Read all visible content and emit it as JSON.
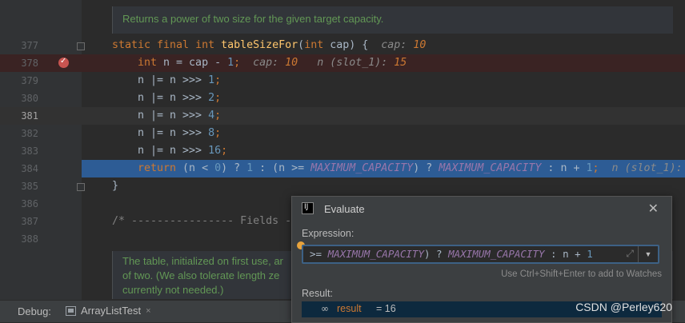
{
  "doc_top": {
    "text": "Returns a power of two size for the given target capacity."
  },
  "lines": [
    {
      "num": "377"
    },
    {
      "num": "378"
    },
    {
      "num": "379"
    },
    {
      "num": "380"
    },
    {
      "num": "381"
    },
    {
      "num": "382"
    },
    {
      "num": "383"
    },
    {
      "num": "384"
    },
    {
      "num": "385"
    },
    {
      "num": "386"
    },
    {
      "num": "387"
    },
    {
      "num": "388"
    }
  ],
  "code": {
    "l377": {
      "kw": "static final int ",
      "fn": "tableSizeFor",
      "rest1": "(",
      "kw2": "int",
      "rest2": " cap) {",
      "hint": "cap: ",
      "hintv": "10"
    },
    "l378": {
      "kw": "int ",
      "rest": "n = cap - ",
      "num": "1",
      "semi": ";",
      "hint1": "cap: ",
      "hintv1": "10",
      "hint2": "n (slot_1): ",
      "hintv2": "15"
    },
    "l379": {
      "rest": "n |= n >>> ",
      "num": "1",
      "semi": ";"
    },
    "l380": {
      "rest": "n |= n >>> ",
      "num": "2",
      "semi": ";"
    },
    "l381": {
      "rest": "n |= n >>> ",
      "num": "4",
      "semi": ";"
    },
    "l382": {
      "rest": "n |= n >>> ",
      "num": "8",
      "semi": ";"
    },
    "l383": {
      "rest": "n |= n >>> ",
      "num": "16",
      "semi": ";"
    },
    "l384": {
      "kw": "return ",
      "p1": "(n < ",
      "n0": "0",
      "p2": ") ? ",
      "n1": "1",
      "p3": " : (n >= ",
      "c1": "MAXIMUM_CAPACITY",
      "p4": ") ? ",
      "c2": "MAXIMUM_CAPACITY",
      "p5": " : n + ",
      "n2": "1",
      "p6": ";",
      "hint": "n (slot_1):"
    },
    "l385": {
      "rest": "}"
    },
    "l387": {
      "comment": "/* ---------------- Fields -"
    }
  },
  "doc_bottom": {
    "line1": "The table, initialized on first use, ar",
    "line2": "of two. (We also tolerate length ze",
    "line3": "currently not needed.)"
  },
  "debug": {
    "label": "Debug:",
    "tab": "ArrayListTest",
    "close": "×"
  },
  "dialog": {
    "logo": "IJ",
    "title": "Evaluate",
    "close": "✕",
    "expression_label": "Expression:",
    "expression": {
      "p1": ">= ",
      "c1": "MAXIMUM_CAPACITY",
      "p2": ") ? ",
      "c2": "MAXIMUM_CAPACITY",
      "p3": " : n + ",
      "n": "1"
    },
    "expand_icon": "⤢",
    "dropdown_icon": "▼",
    "watch_hint": "Use Ctrl+Shift+Enter to add to Watches",
    "result_label": "Result:",
    "result_icon": "∞",
    "result_name": "result",
    "result_value": "= 16"
  },
  "watermark": "CSDN @Perley620",
  "colors": {
    "execution_line": "#2d5c95",
    "breakpoint": "#c75450",
    "keyword": "#cc7832",
    "number": "#6897bb",
    "constant": "#9876aa"
  }
}
